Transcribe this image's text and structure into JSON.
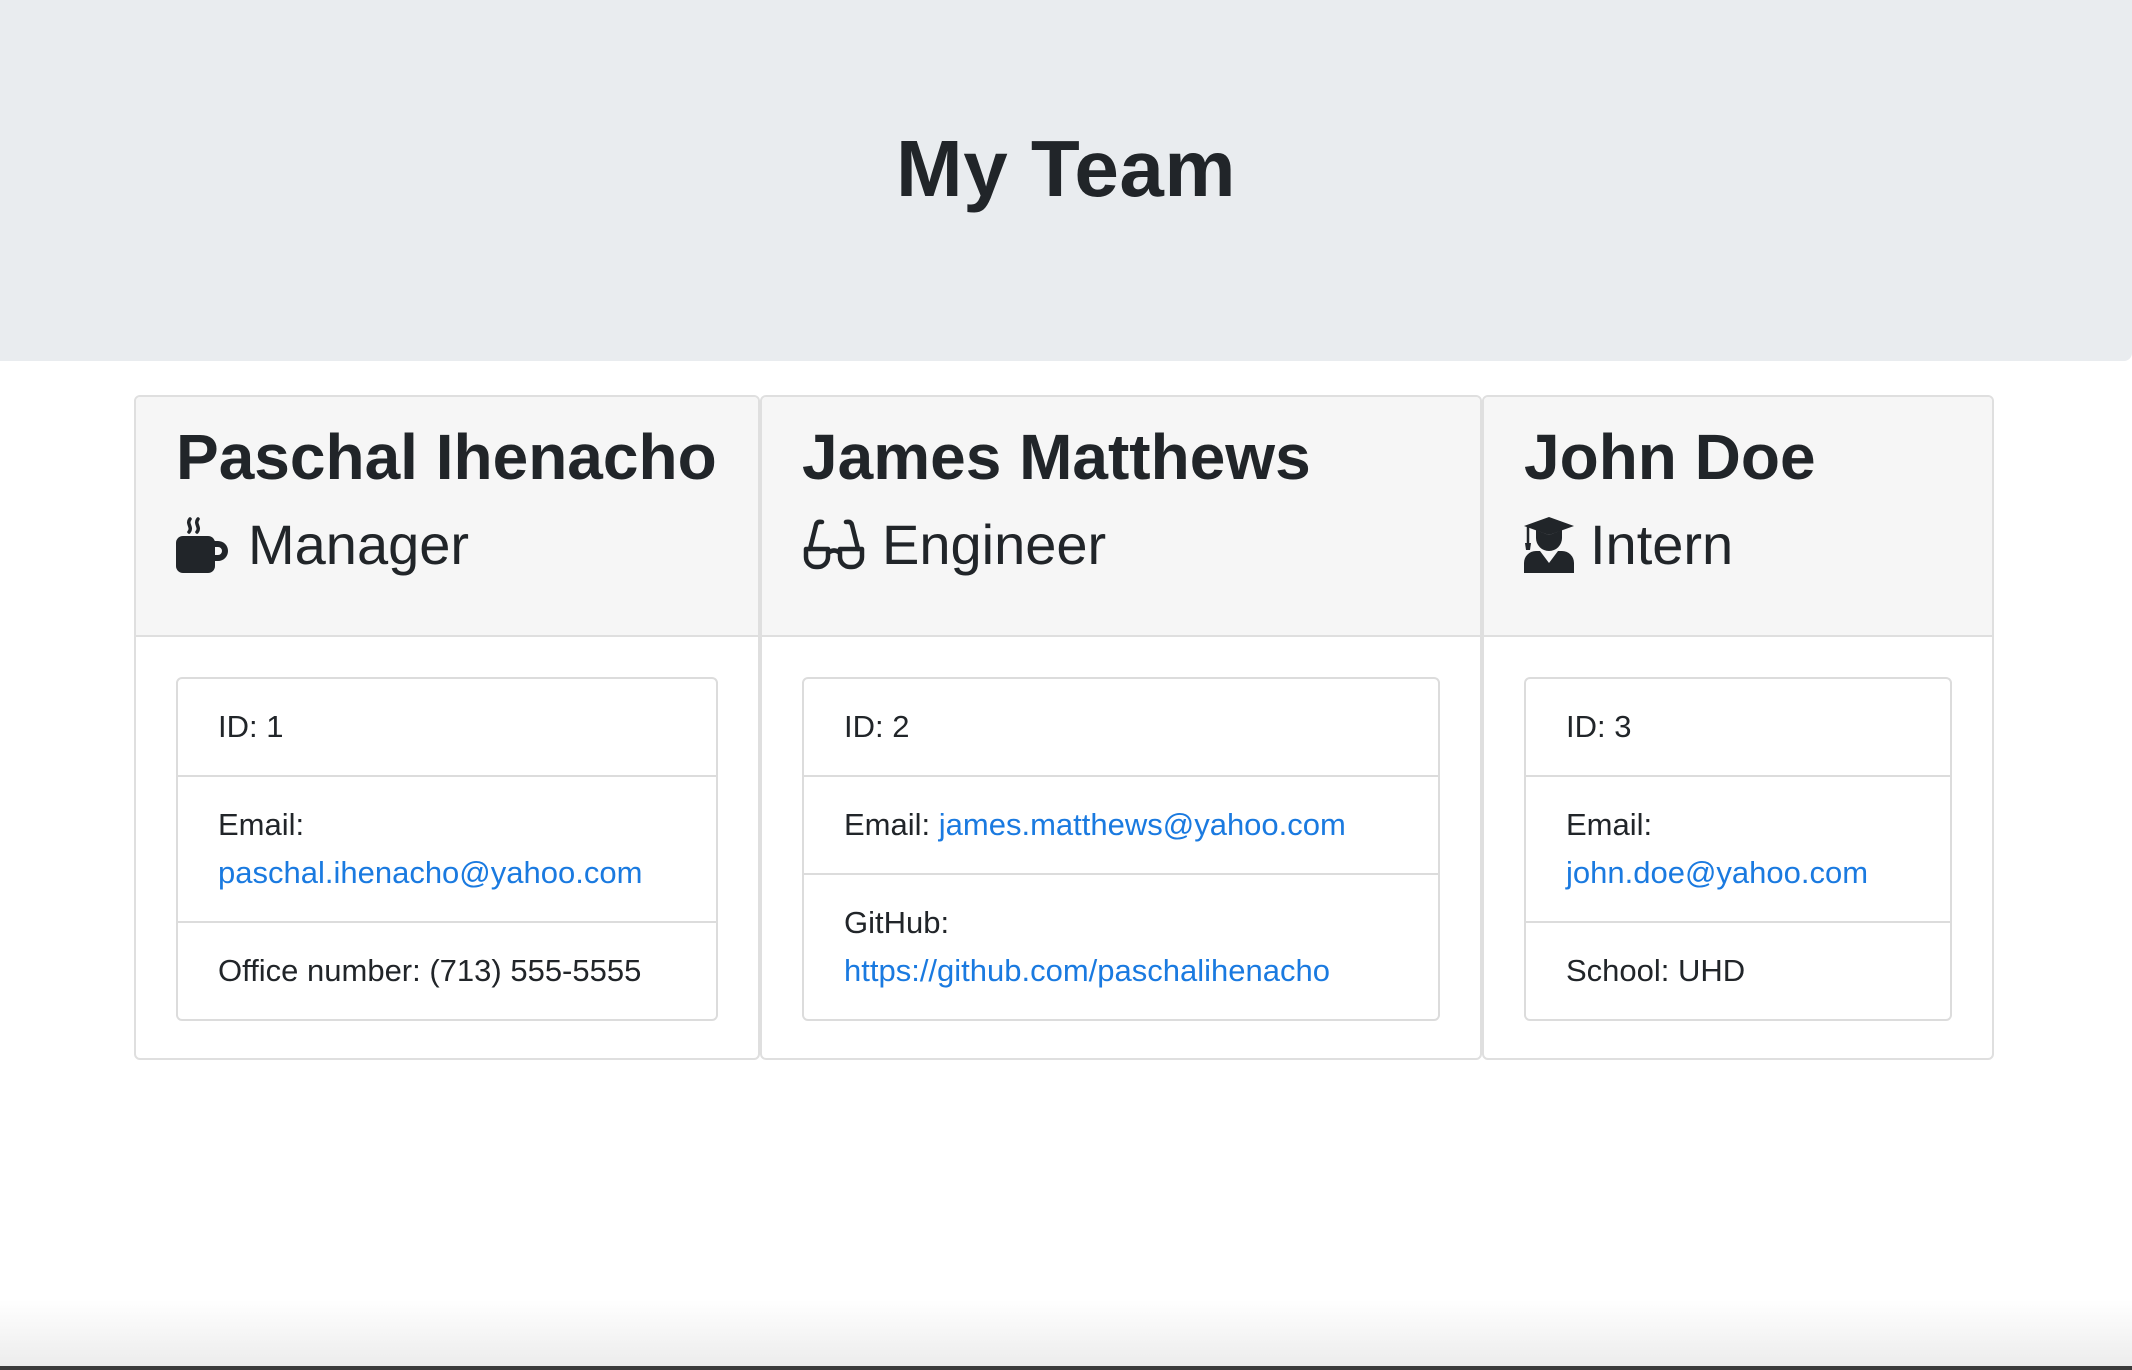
{
  "header": {
    "title": "My Team"
  },
  "team": [
    {
      "name": "Paschal Ihenacho",
      "role": "Manager",
      "role_icon": "coffee-mug-icon",
      "id_text": "ID: 1",
      "email_label": "Email:",
      "email": "paschal.ihenacho@yahoo.com",
      "extra_label": "Office number: (713) 555-5555"
    },
    {
      "name": "James Matthews",
      "role": "Engineer",
      "role_icon": "glasses-icon",
      "id_text": "ID: 2",
      "email_label": "Email:",
      "email": "james.matthews@yahoo.com",
      "extra_label": "GitHub:",
      "extra_link": "https://github.com/paschalihenacho"
    },
    {
      "name": "John Doe",
      "role": "Intern",
      "role_icon": "graduate-icon",
      "id_text": "ID: 3",
      "email_label": "Email:",
      "email": "john.doe@yahoo.com",
      "extra_label": "School: UHD"
    }
  ],
  "colors": {
    "link": "#1a7ae0",
    "header_bg": "#e9ecef",
    "card_header_bg": "#f6f6f6"
  }
}
